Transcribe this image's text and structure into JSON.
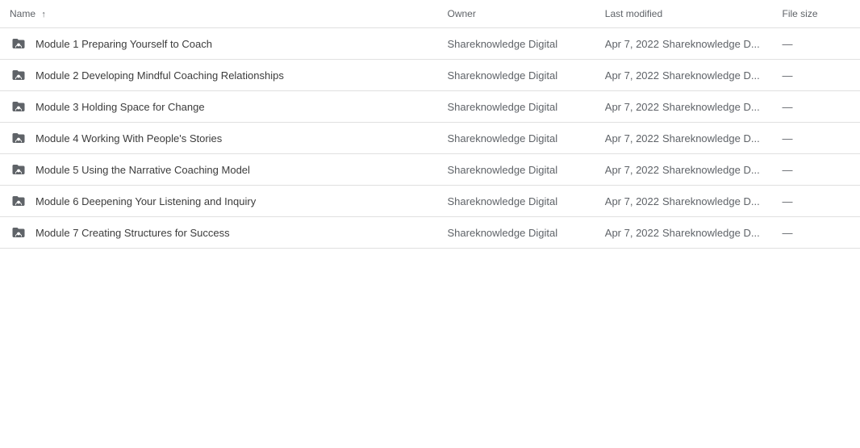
{
  "table": {
    "headers": {
      "name": "Name",
      "owner": "Owner",
      "modified": "Last modified",
      "size": "File size"
    },
    "rows": [
      {
        "id": 1,
        "name": "Module 1 Preparing Yourself to Coach",
        "owner": "Shareknowledge Digital",
        "modified_date": "Apr 7, 2022",
        "modified_user": "Shareknowledge D...",
        "size": "—"
      },
      {
        "id": 2,
        "name": "Module 2 Developing Mindful Coaching Relationships",
        "owner": "Shareknowledge Digital",
        "modified_date": "Apr 7, 2022",
        "modified_user": "Shareknowledge D...",
        "size": "—"
      },
      {
        "id": 3,
        "name": "Module 3 Holding Space for Change",
        "owner": "Shareknowledge Digital",
        "modified_date": "Apr 7, 2022",
        "modified_user": "Shareknowledge D...",
        "size": "—"
      },
      {
        "id": 4,
        "name": "Module 4 Working With People's Stories",
        "owner": "Shareknowledge Digital",
        "modified_date": "Apr 7, 2022",
        "modified_user": "Shareknowledge D...",
        "size": "—"
      },
      {
        "id": 5,
        "name": "Module 5 Using the Narrative Coaching Model",
        "owner": "Shareknowledge Digital",
        "modified_date": "Apr 7, 2022",
        "modified_user": "Shareknowledge D...",
        "size": "—"
      },
      {
        "id": 6,
        "name": "Module 6 Deepening Your Listening and Inquiry",
        "owner": "Shareknowledge Digital",
        "modified_date": "Apr 7, 2022",
        "modified_user": "Shareknowledge D...",
        "size": "—"
      },
      {
        "id": 7,
        "name": "Module 7 Creating Structures for Success",
        "owner": "Shareknowledge Digital",
        "modified_date": "Apr 7, 2022",
        "modified_user": "Shareknowledge D...",
        "size": "—"
      }
    ]
  }
}
